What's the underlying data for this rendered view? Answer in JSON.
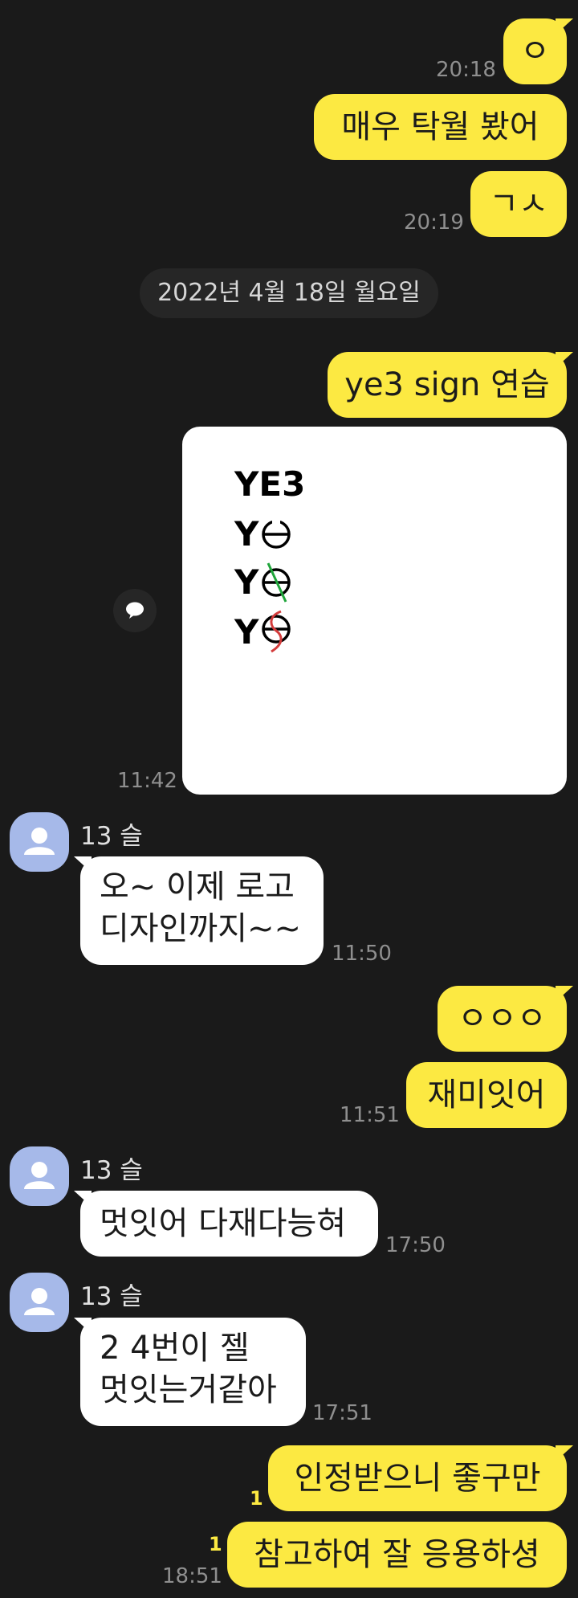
{
  "colors": {
    "background": "#1a1a1a",
    "my_bubble": "#fce942",
    "their_bubble": "#ffffff",
    "avatar": "#a6b9e9",
    "unread": "#fce942"
  },
  "messages": {
    "m1": {
      "text": "ㅇ",
      "time": "20:18"
    },
    "m2": {
      "text": "매우 탁월  봤어"
    },
    "m3": {
      "text": "ㄱㅅ",
      "time": "20:19"
    },
    "date_divider": "2022년 4월 18일 월요일",
    "m4": {
      "text": "ye3 sign 연습"
    },
    "m5": {
      "time": "11:42",
      "image_lines": [
        "YE3",
        "Y",
        "Y",
        "Y"
      ],
      "share_icon": "speech-bubble-icon"
    },
    "m6": {
      "sender": "13 슬",
      "text_line1": "오~ 이제 로고",
      "text_line2": "디자인까지~~",
      "time": "11:50"
    },
    "m7": {
      "text": "ㅇㅇㅇ"
    },
    "m8": {
      "text": "재미잇어",
      "time": "11:51"
    },
    "m9": {
      "sender": "13 슬",
      "text": "멋잇어 다재다능혀",
      "time": "17:50"
    },
    "m10": {
      "sender": "13 슬",
      "text_line1": "2 4번이 젤",
      "text_line2": "멋잇는거같아",
      "time": "17:51"
    },
    "m11": {
      "text": "인정받으니 좋구만",
      "unread": "1"
    },
    "m12": {
      "text": "참고하여 잘 응용하셩",
      "unread": "1",
      "time": "18:51"
    }
  }
}
